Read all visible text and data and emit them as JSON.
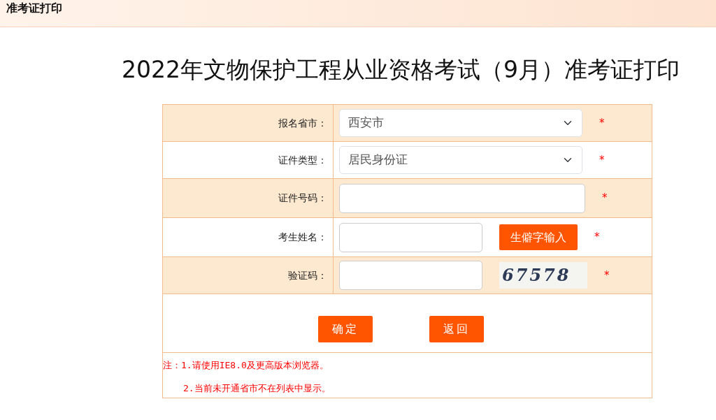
{
  "header": {
    "title": "准考证打印"
  },
  "page_title": "2022年文物保护工程从业资格考试（9月）准考证打印",
  "form": {
    "rows": [
      {
        "kind": "select",
        "label": "报名省市：",
        "value": "西安市",
        "required_mark": "*"
      },
      {
        "kind": "select",
        "label": "证件类型：",
        "value": "居民身份证",
        "required_mark": "*"
      },
      {
        "kind": "text",
        "label": "证件号码：",
        "required_mark": "*"
      },
      {
        "kind": "text_button",
        "label": "考生姓名：",
        "button": "生僻字输入",
        "required_mark": "*"
      },
      {
        "kind": "captcha",
        "label": "验证码：",
        "captcha": "67578",
        "required_mark": "*"
      }
    ],
    "buttons": [
      "确定",
      "返回"
    ],
    "notes": [
      "注：1.请使用IE8.0及更高版本浏览器。",
      "2.当前未开通省市不在列表中显示。"
    ]
  }
}
